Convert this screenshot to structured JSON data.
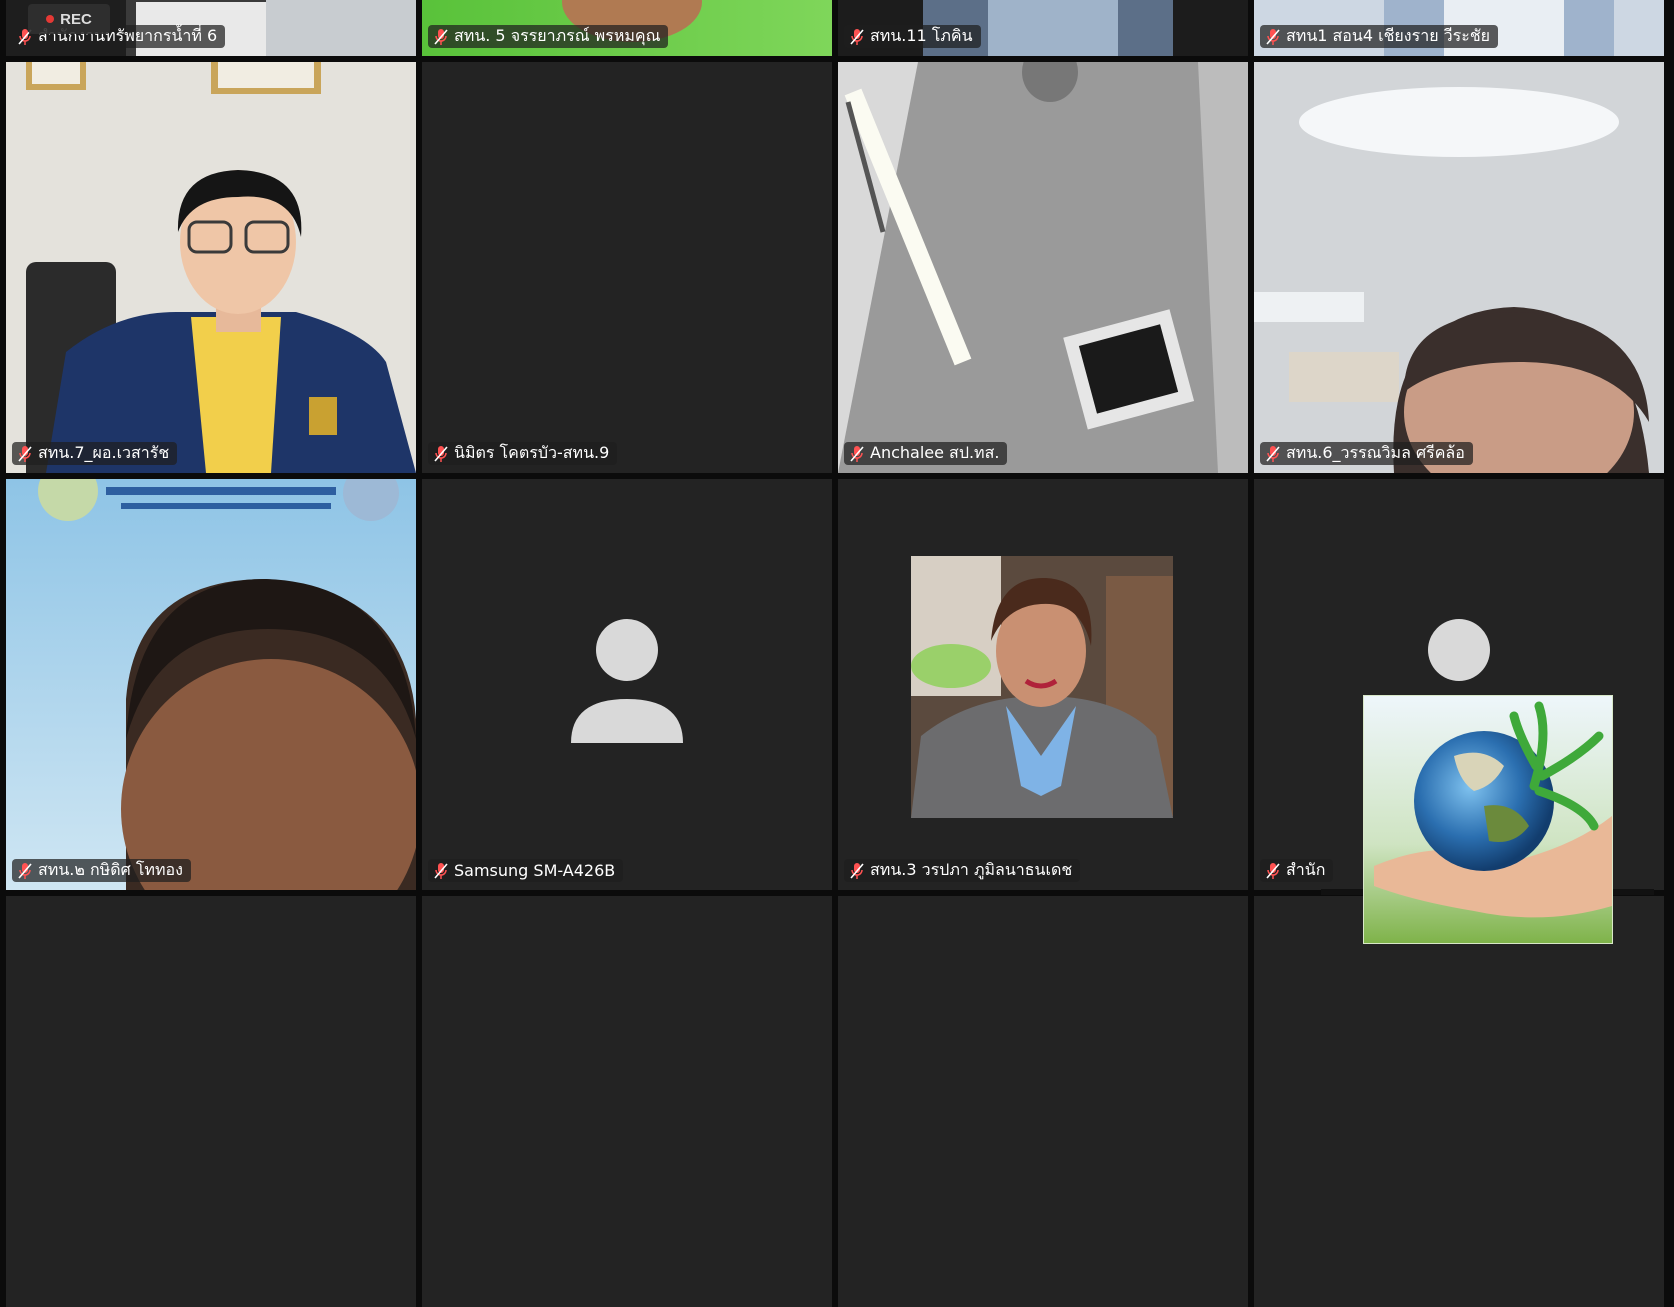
{
  "recording": {
    "label": "REC"
  },
  "participants": [
    {
      "name": "สำนักงานทรัพยากรน้ำที่ 6",
      "display": "​ทรัพยากรน้ำที่ 6"
    },
    {
      "name": "สทน. 5 จรรยาภรณ์ พรหมคุณ"
    },
    {
      "name": "สทน.11 โภคิน"
    },
    {
      "name": "สทน1 สอน4 เชียงราย วีระชัย"
    },
    {
      "name": "สทน.7_ผอ.เวสารัช"
    },
    {
      "name": "นิมิตร โคตรบัว-สทน.9"
    },
    {
      "name": "Anchalee สป.ทส."
    },
    {
      "name": "สทน.6_วรรณวิมล ศรีคล้อ"
    },
    {
      "name": "สทน.๒ กษิดิศ โททอง"
    },
    {
      "name": "Samsung SM-A426B"
    },
    {
      "name": "สทน.3 วรปภา ภูมิลนาธนเดช"
    },
    {
      "name": "สำนัก"
    }
  ],
  "icons": {
    "mic": "mic-muted-icon",
    "avatar": "person-avatar-icon",
    "rec_dot": "record-dot-icon"
  },
  "colors": {
    "tile_bg": "#232323",
    "rec_dot": "#e53935",
    "avatar": "#d9d9d9"
  }
}
